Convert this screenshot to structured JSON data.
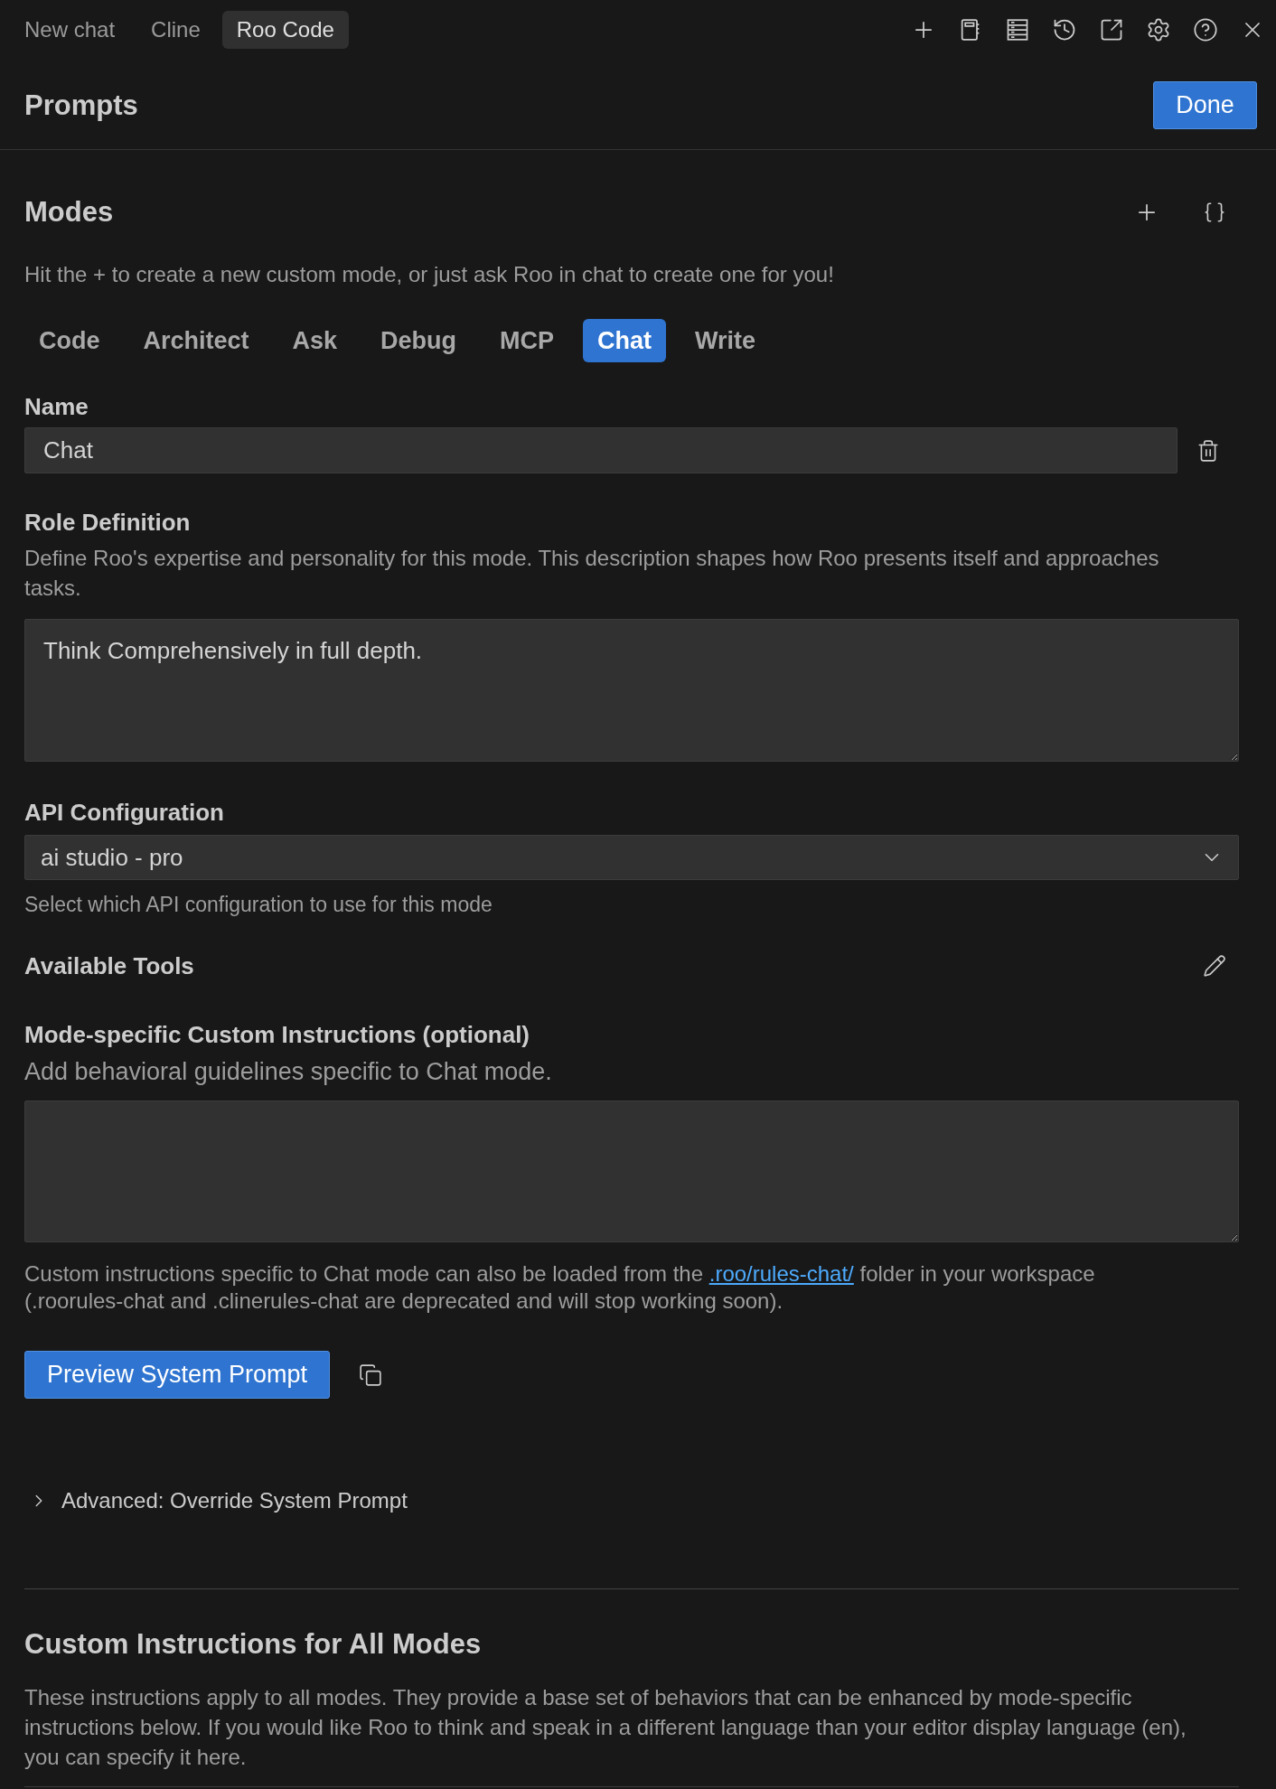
{
  "top_tabs": [
    {
      "label": "New chat",
      "selected": false
    },
    {
      "label": "Cline",
      "selected": false
    },
    {
      "label": "Roo Code",
      "selected": true
    }
  ],
  "header": {
    "title": "Prompts",
    "done_button": "Done"
  },
  "modes": {
    "title": "Modes",
    "hint": "Hit the + to create a new custom mode, or just ask Roo in chat to create one for you!",
    "tabs": [
      {
        "label": "Code",
        "selected": false
      },
      {
        "label": "Architect",
        "selected": false
      },
      {
        "label": "Ask",
        "selected": false
      },
      {
        "label": "Debug",
        "selected": false
      },
      {
        "label": "MCP",
        "selected": false
      },
      {
        "label": "Chat",
        "selected": true
      },
      {
        "label": "Write",
        "selected": false
      }
    ]
  },
  "name_field": {
    "label": "Name",
    "value": "Chat"
  },
  "role_definition": {
    "label": "Role Definition",
    "description": "Define Roo's expertise and personality for this mode. This description shapes how Roo presents itself and approaches tasks.",
    "value": "Think Comprehensively in full depth."
  },
  "api_configuration": {
    "label": "API Configuration",
    "value": "ai studio - pro",
    "help": "Select which API configuration to use for this mode"
  },
  "available_tools": {
    "label": "Available Tools"
  },
  "mode_instructions": {
    "label": "Mode-specific Custom Instructions (optional)",
    "description": "Add behavioral guidelines specific to Chat mode.",
    "help_before": "Custom instructions specific to Chat mode can also be loaded from the",
    "help_link": ".roo/rules-chat/",
    "help_after": "folder in your workspace (.roorules-chat and .clinerules-chat are deprecated and will stop working soon)."
  },
  "preview_button": "Preview System Prompt",
  "advanced": {
    "label": "Advanced: Override System Prompt",
    "expanded": false
  },
  "global_instructions": {
    "title": "Custom Instructions for All Modes",
    "description": "These instructions apply to all modes. They provide a base set of behaviors that can be enhanced by mode-specific instructions below. If you would like Roo to think and speak in a different language than your editor display language (en), you can specify it here."
  }
}
